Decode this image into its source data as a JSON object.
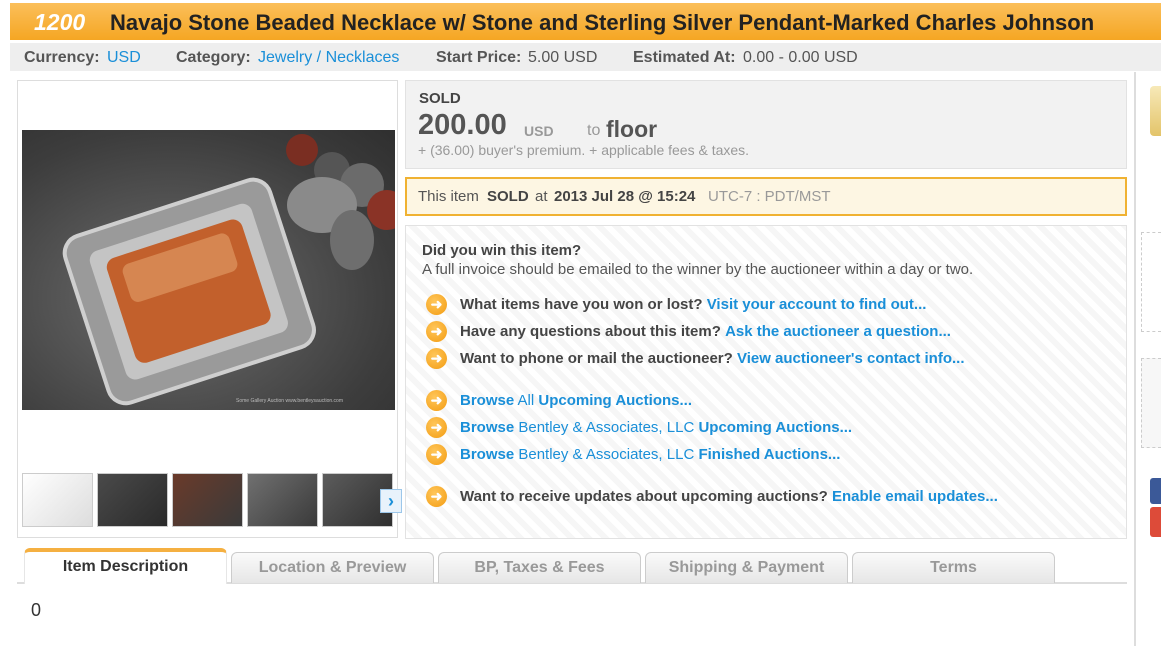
{
  "header": {
    "lot_number": "1200",
    "title": "Navajo Stone Beaded Necklace w/ Stone and Sterling Silver Pendant-Marked Charles Johnson"
  },
  "info": {
    "currency_label": "Currency:",
    "currency_value": "USD",
    "category_label": "Category:",
    "category_value": "Jewelry / Necklaces",
    "start_price_label": "Start Price:",
    "start_price_value": "5.00 USD",
    "estimated_label": "Estimated At:",
    "estimated_value": "0.00 - 0.00 USD"
  },
  "image": {
    "watermark": "Some Gallery Auction   www.bentleysauction.com",
    "thumbnail_count": 5
  },
  "sold": {
    "label": "SOLD",
    "price": "200.00",
    "currency": "USD",
    "to": "to",
    "buyer": "floor",
    "premium": "+ (36.00) buyer's premium. + applicable fees & taxes."
  },
  "notice": {
    "prefix": "This item",
    "sold": "SOLD",
    "at": "at",
    "datetime": "2013 Jul 28 @ 15:24",
    "tz": "UTC-7 : PDT/MST"
  },
  "win": {
    "question": "Did you win this item?",
    "info": "A full invoice should be emailed to the winner by the auctioneer within a day or two.",
    "links": [
      {
        "q": "What items have you won or lost?",
        "a": "Visit your account to find out..."
      },
      {
        "q": "Have any questions about this item?",
        "a": "Ask the auctioneer a question..."
      },
      {
        "q": "Want to phone or mail the auctioneer?",
        "a": "View auctioneer's contact info..."
      }
    ],
    "browse": [
      {
        "b": "Browse",
        "m": "All",
        "e": "Upcoming Auctions..."
      },
      {
        "b": "Browse",
        "m": "Bentley & Associates, LLC",
        "e": "Upcoming Auctions..."
      },
      {
        "b": "Browse",
        "m": "Bentley & Associates, LLC",
        "e": "Finished Auctions..."
      }
    ],
    "updates": {
      "q": "Want to receive updates about upcoming auctions?",
      "a": "Enable email updates..."
    }
  },
  "tabs": [
    {
      "label": "Item Description",
      "active": true
    },
    {
      "label": "Location & Preview",
      "active": false
    },
    {
      "label": "BP, Taxes & Fees",
      "active": false
    },
    {
      "label": "Shipping & Payment",
      "active": false
    },
    {
      "label": "Terms",
      "active": false
    }
  ],
  "description": "0",
  "colors": {
    "title_bar": "#f5a623",
    "link": "#1a8fd8",
    "notice_border": "#f0b232"
  }
}
